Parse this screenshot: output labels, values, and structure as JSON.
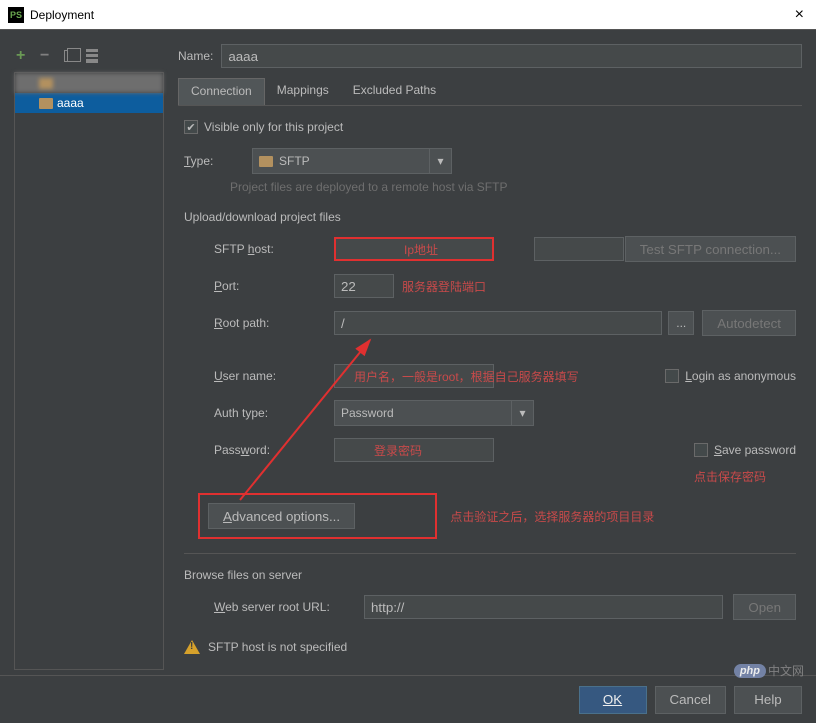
{
  "window": {
    "title": "Deployment"
  },
  "sidebar": {
    "items": [
      "",
      "aaaa"
    ]
  },
  "form": {
    "name_label": "Name:",
    "name_value": "aaaa"
  },
  "tabs": {
    "connection": "Connection",
    "mappings": "Mappings",
    "excluded": "Excluded Paths"
  },
  "connection": {
    "visible_project": "Visible only for this project",
    "type_label": "Type:",
    "type_value": "SFTP",
    "deploy_hint": "Project files are deployed to a remote host via SFTP",
    "upload_section": "Upload/download project files",
    "sftp_host_label": "SFTP host:",
    "sftp_host_value": "",
    "test_btn": "Test SFTP connection...",
    "port_label": "Port:",
    "port_value": "22",
    "root_label": "Root path:",
    "root_value": "/",
    "autodetect_btn": "Autodetect",
    "user_label": "User name:",
    "user_value": "",
    "login_anon": "Login as anonymous",
    "auth_label": "Auth type:",
    "auth_value": "Password",
    "password_label": "Password:",
    "password_value": "",
    "save_password": "Save password",
    "advanced_btn": "Advanced options...",
    "browse_section": "Browse files on server",
    "web_url_label": "Web server root URL:",
    "web_url_value": "http://",
    "open_btn": "Open",
    "warning": "SFTP host is not specified"
  },
  "annotations": {
    "ip_addr": "Ip地址",
    "port_hint": "服务器登陆端口",
    "user_hint": "用户名，一般是root，根据自己服务器填写",
    "pwd_hint": "登录密码",
    "save_pwd_hint": "点击保存密码",
    "advanced_hint": "点击验证之后，选择服务器的项目目录"
  },
  "footer": {
    "ok": "OK",
    "cancel": "Cancel",
    "help": "Help"
  },
  "watermark": {
    "badge": "php",
    "text": "中文网"
  }
}
